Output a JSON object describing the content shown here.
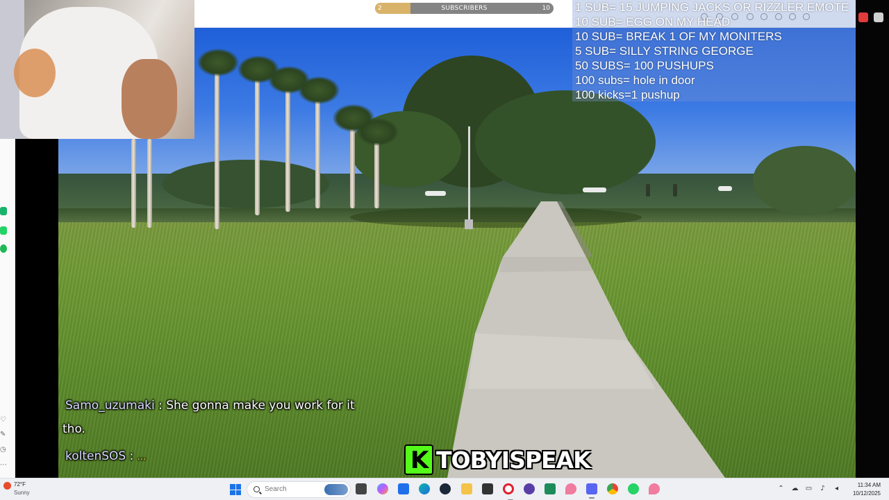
{
  "subscriber_goal": {
    "current": "2",
    "target": "10",
    "label": "SUBSCRIBERS",
    "progress_fraction": 0.2,
    "fill_color": "#d9b36a"
  },
  "goals": [
    "1 SUB= 15 JUMPING JACKS OR RIZZLER EMOTE",
    "10 SUB= EGG ON MY HEAD",
    "10 SUB= BREAK 1 OF MY MONITERS",
    "5 SUB= SILLY STRING GEORGE",
    "50 SUBS= 100 PUSHUPS",
    "100 subs= hole in door",
    "100 kicks=1 pushup"
  ],
  "chat": [
    {
      "user": "Samo_uzumaki",
      "separator": ":",
      "message": "She gonna make you work for it",
      "continuation": "tho."
    },
    {
      "user": "koltenSOS",
      "separator": ":",
      "message": "",
      "emote": "..."
    }
  ],
  "brand": {
    "icon_letter": "K",
    "name": "TOBYISPEAK",
    "icon_color": "#53fc18"
  },
  "taskbar": {
    "weather_temp": "72°F",
    "weather_condition": "Sunny",
    "search_placeholder": "Search",
    "time": "11:34 AM",
    "date": "10/12/2025",
    "apps": [
      "taskview-icon",
      "file-explorer-icon",
      "copilot-icon",
      "store-icon",
      "edge-icon",
      "steam-icon",
      "folder-icon",
      "game-icon",
      "opera-icon",
      "app-icon",
      "app-icon-2",
      "map-pin-icon",
      "discord-icon",
      "chrome-icon",
      "whatsapp-icon",
      "map-pin-icon-2"
    ]
  }
}
